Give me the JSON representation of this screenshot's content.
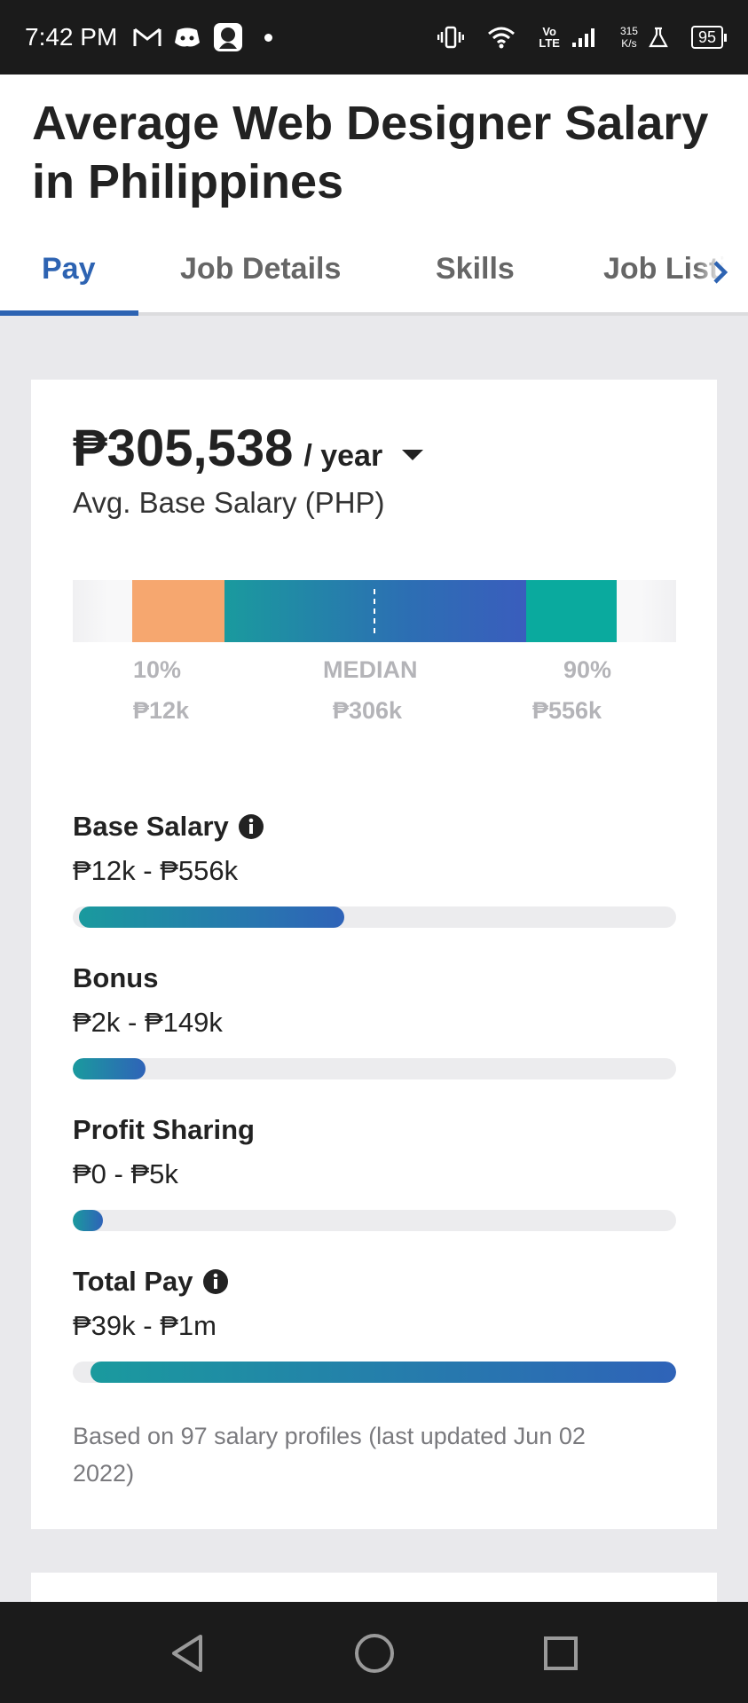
{
  "status_bar": {
    "time": "7:42 PM",
    "icons": [
      "gmail-icon",
      "discord-icon",
      "app-icon",
      "vibrate-icon",
      "wifi-icon",
      "signal-icon",
      "lab-icon"
    ],
    "volte": "Vo",
    "lte": "LTE",
    "net_speed_value": "315",
    "net_speed_unit": "K/s",
    "battery": "95"
  },
  "header": {
    "title": "Average Web Designer Salary in Philippines",
    "tabs": [
      {
        "label": "Pay",
        "active": true
      },
      {
        "label": "Job Details",
        "active": false
      },
      {
        "label": "Skills",
        "active": false
      },
      {
        "label": "Job Listings",
        "active": false
      }
    ]
  },
  "salary": {
    "amount": "₱305,538",
    "period": "/ year",
    "label": "Avg. Base Salary (PHP)"
  },
  "percentiles": {
    "p10_label": "10%",
    "p10_value": "₱12k",
    "median_label": "MEDIAN",
    "median_value": "₱306k",
    "p90_label": "90%",
    "p90_value": "₱556k"
  },
  "components": [
    {
      "title": "Base Salary",
      "info": true,
      "range": "₱12k - ₱556k",
      "fill_start": 0.01,
      "fill_end": 0.45
    },
    {
      "title": "Bonus",
      "info": false,
      "range": "₱2k - ₱149k",
      "fill_start": 0.0,
      "fill_end": 0.12
    },
    {
      "title": "Profit Sharing",
      "info": false,
      "range": "₱0 - ₱5k",
      "fill_start": 0.0,
      "fill_end": 0.05
    },
    {
      "title": "Total Pay",
      "info": true,
      "range": "₱39k - ₱1m",
      "fill_start": 0.03,
      "fill_end": 1.0
    }
  ],
  "footnote": "Based on 97 salary profiles (last updated Jun 02 2022)",
  "colors": {
    "accent": "#2d63b2",
    "p10": "#f6a76f",
    "p90": "#0aaa9e",
    "teal": "#1a9a9e"
  },
  "nav": {
    "icons": [
      "back-icon",
      "home-icon",
      "recents-icon"
    ]
  }
}
